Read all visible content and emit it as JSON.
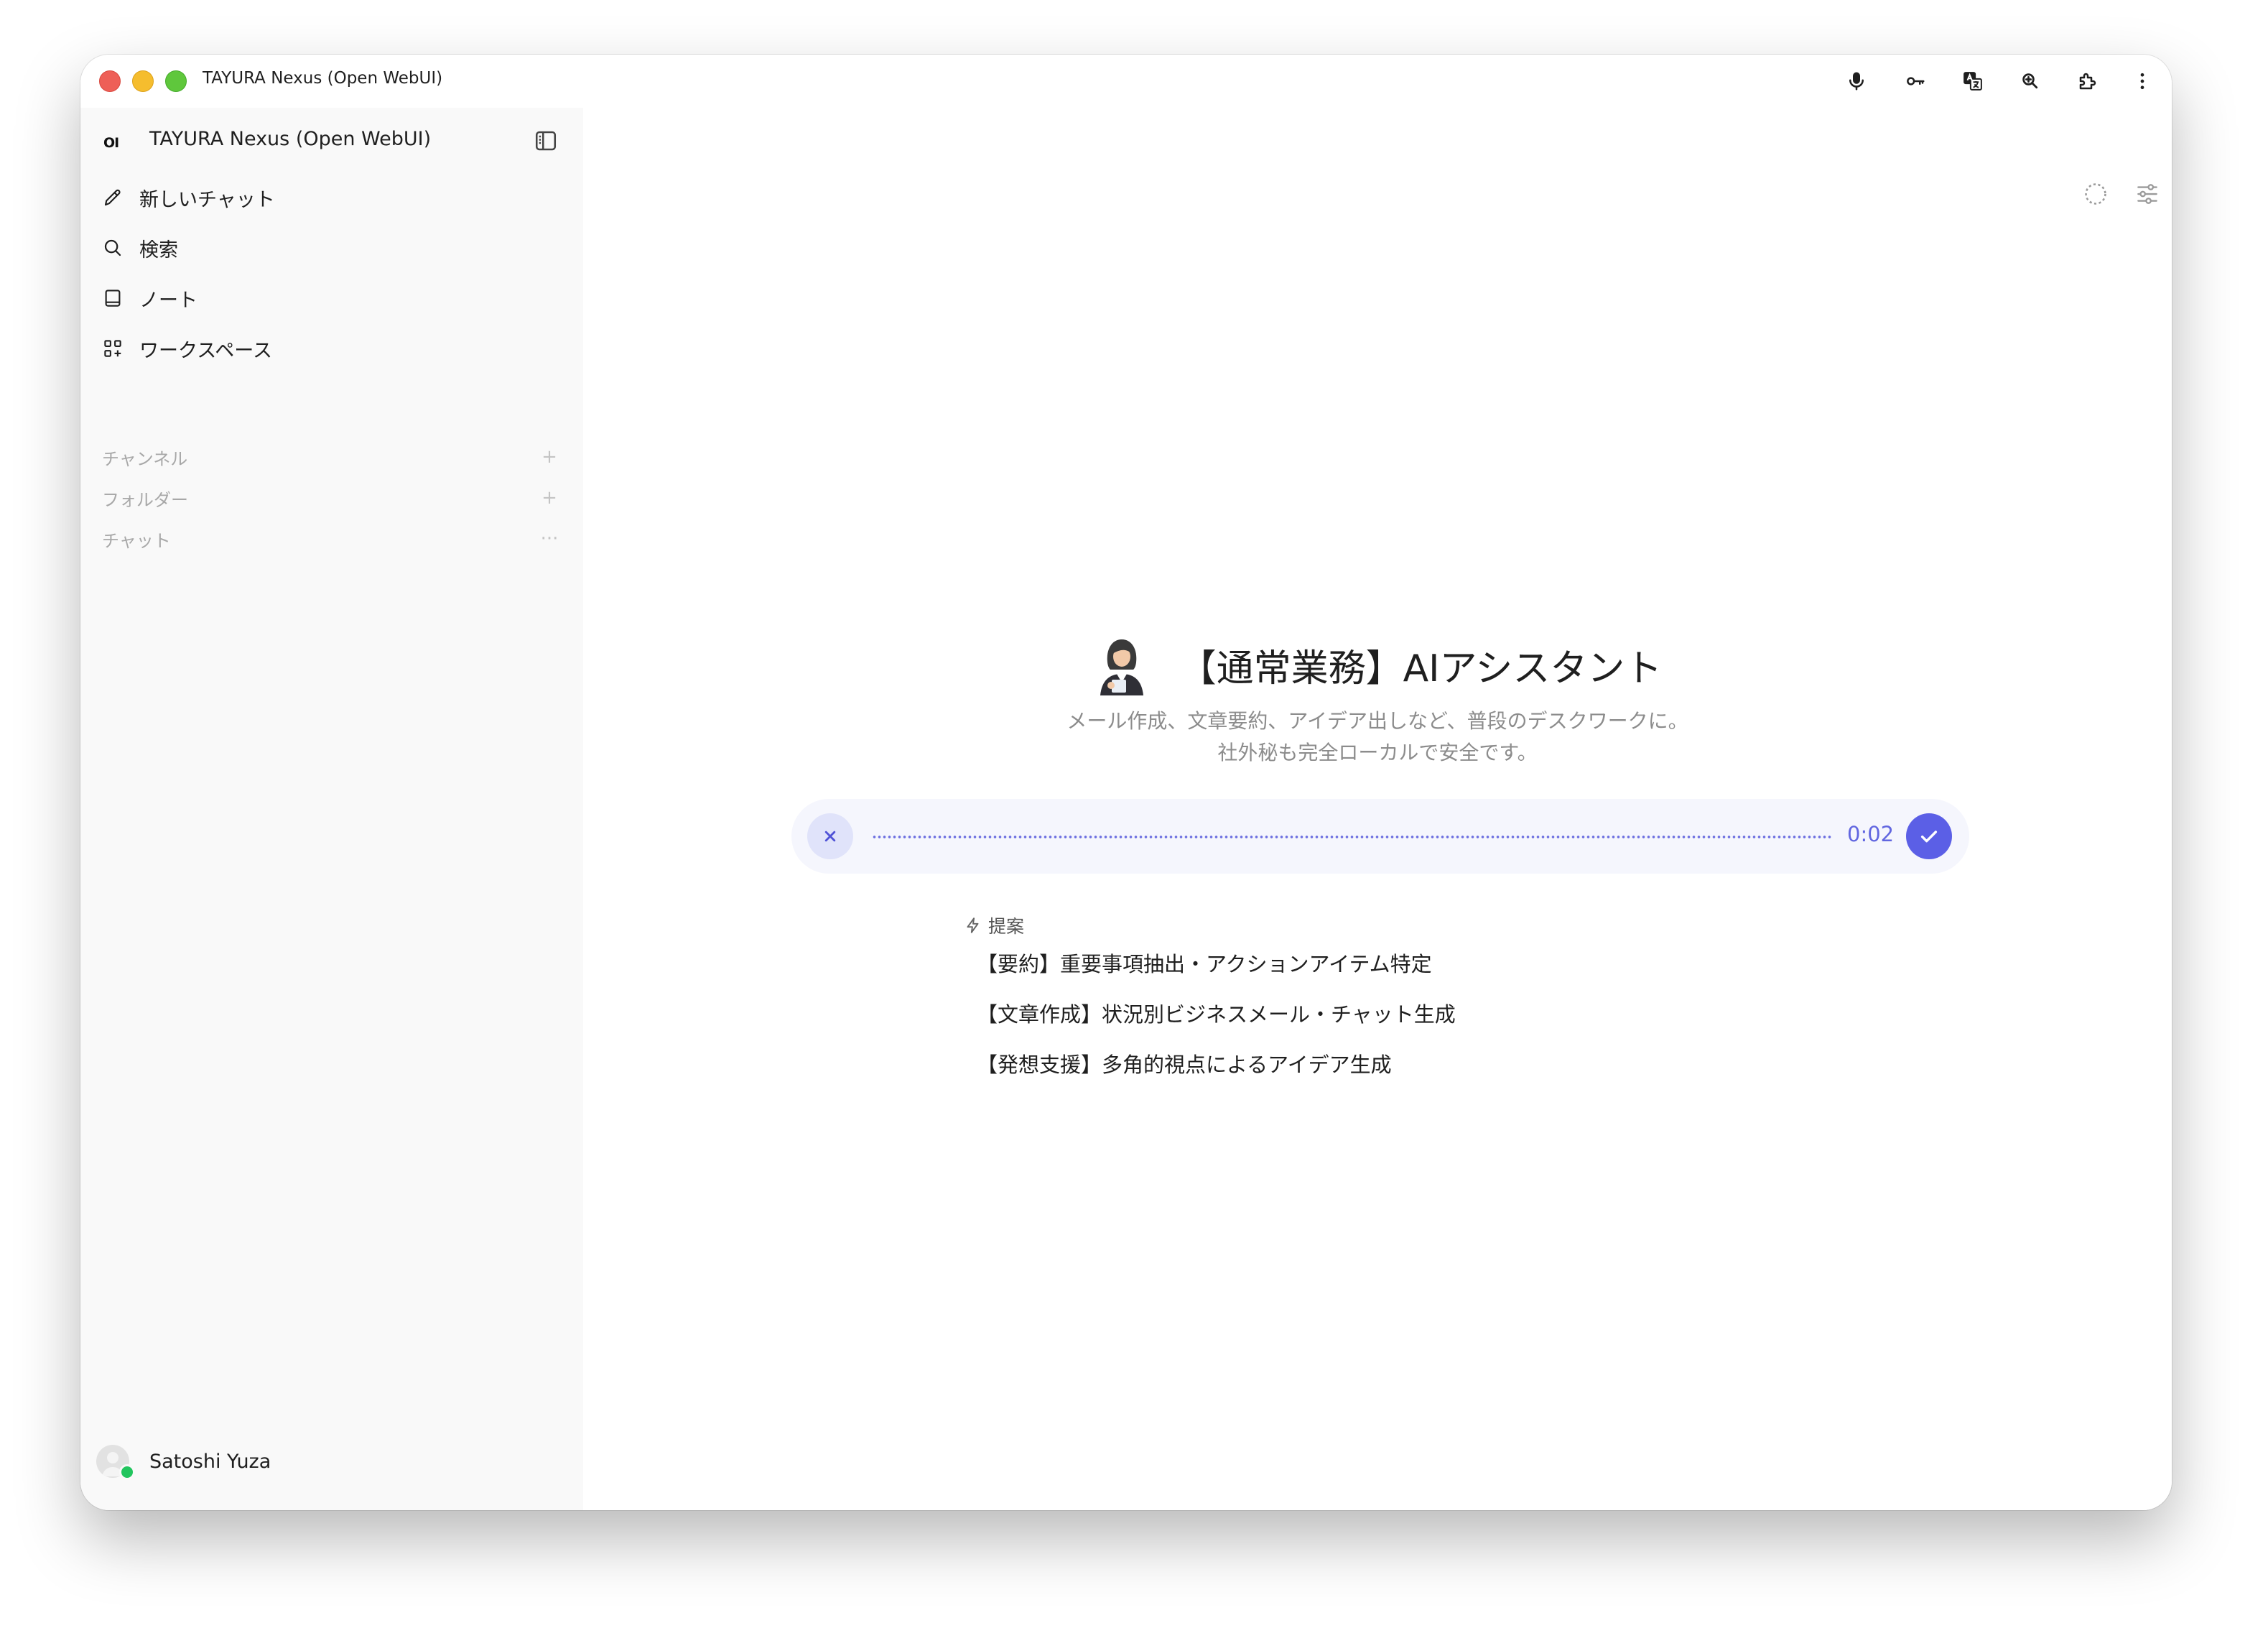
{
  "window": {
    "title": "TAYURA Nexus (Open WebUI)"
  },
  "toolbar_icons": [
    "microphone-icon",
    "key-icon",
    "translate-icon",
    "zoom-icon",
    "extension-icon",
    "more-vertical-icon"
  ],
  "sidebar": {
    "logo": "OI",
    "title": "TAYURA Nexus (Open WebUI)",
    "nav": [
      {
        "label": "新しいチャット",
        "icon": "pencil-icon"
      },
      {
        "label": "検索",
        "icon": "search-icon"
      },
      {
        "label": "ノート",
        "icon": "note-icon"
      },
      {
        "label": "ワークスペース",
        "icon": "workspace-icon"
      }
    ],
    "sections": [
      {
        "label": "チャンネル",
        "action": "+"
      },
      {
        "label": "フォルダー",
        "action": "+"
      },
      {
        "label": "チャット",
        "action": "···"
      }
    ],
    "user": {
      "name": "Satoshi Yuza",
      "status": "online"
    }
  },
  "main": {
    "model_title": "【通常業務】AIアシスタント",
    "description_line1": "メール作成、文章要約、アイデア出しなど、普段のデスクワークに。",
    "description_line2": "社外秘も完全ローカルで安全です。",
    "recording": {
      "time": "0:02"
    },
    "suggestions_label": "提案",
    "suggestions": [
      "【要約】重要事項抽出・アクションアイテム特定",
      "【文章作成】状況別ビジネスメール・チャット生成",
      "【発想支援】多角的視点によるアイデア生成"
    ]
  },
  "colors": {
    "accent": "#5b5fe6",
    "recording_bar": "#f5f6fd",
    "sidebar_bg": "#f9f9f9",
    "online": "#22c55e"
  }
}
